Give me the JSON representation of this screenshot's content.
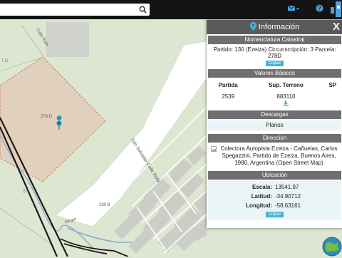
{
  "search": {
    "value": "",
    "placeholder": ""
  },
  "topbar": {
    "mail_icon": "envelope-icon",
    "help_icon": "question-icon",
    "layers_icon": "layers-icon"
  },
  "map": {
    "labels": {
      "c": "7 C",
      "calle_top": "Calle Ruta",
      "parcel": "278 D",
      "a": "2 A",
      "b": "280 B",
      "road": "San Salvador Calle Ruta",
      "alegre": "Alegre"
    }
  },
  "panel": {
    "title": "Información",
    "close": "X",
    "nomenclatura": {
      "title": "Nomenclatura Catastral",
      "text": "Partido: 130 (Ezeiza) Circunscripción: 3 Parcela: 278D",
      "copy": "Copiar"
    },
    "valores": {
      "title": "Valores Básicos",
      "headers": [
        "Partida",
        "Sup. Terreno",
        "SP"
      ],
      "row": [
        "2539",
        "883110",
        ""
      ]
    },
    "descargas": {
      "title": "Descargas",
      "item": "Planos"
    },
    "direccion": {
      "title": "Dirección",
      "text": "Colectora Autopista Ezeiza - Cañuelas, Carlos Spegazzini, Partido de Ezeiza, Buenos Aires, 1980, Argentina (Open Street Map)"
    },
    "ubicacion": {
      "title": "Ubicación",
      "escala_label": "Escala:",
      "escala": "13541.97",
      "latitud_label": "Latitud:",
      "latitud": "-34.90712",
      "longitud_label": "Longitud:",
      "longitud": "-58.63161",
      "copy": "Copiar"
    }
  },
  "colors": {
    "accent": "#45b3d6",
    "header": "#5a5a5a",
    "section": "#6f6f6f",
    "topbar": "#141414"
  }
}
